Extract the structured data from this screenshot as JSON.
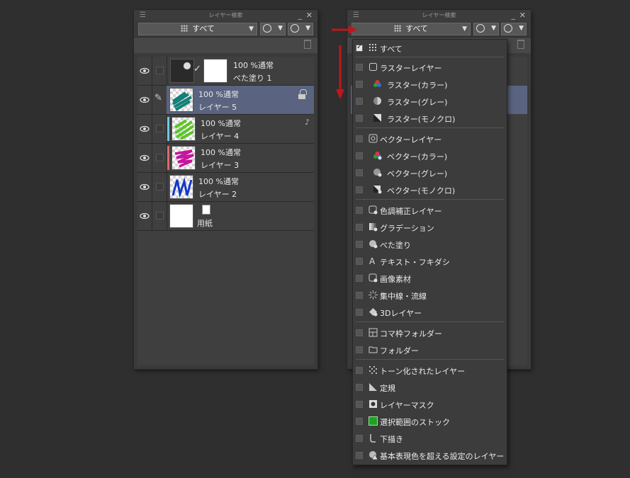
{
  "left_panel": {
    "title": "レイヤー検索",
    "filter_value": "すべて",
    "layers": [
      {
        "mode": "100 %通常",
        "name": "べた塗り 1",
        "selected": false
      },
      {
        "mode": "100 %通常",
        "name": "レイヤー 5",
        "selected": true
      },
      {
        "mode": "100 %通常",
        "name": "レイヤー 4",
        "selected": false,
        "color": "#6ec8e6"
      },
      {
        "mode": "100 %通常",
        "name": "レイヤー 3",
        "selected": false,
        "color": "#e06a6a"
      },
      {
        "mode": "100 %通常",
        "name": "レイヤー 2",
        "selected": false
      },
      {
        "mode": "",
        "name": "用紙",
        "selected": false
      }
    ]
  },
  "right_panel": {
    "title": "レイヤー検索",
    "filter_value": "すべて"
  },
  "dropdown": {
    "items": [
      {
        "label": "すべて",
        "checked": true,
        "icon": "grid-icon"
      },
      {
        "label": "ラスターレイヤー",
        "checked": false,
        "icon": "raster-layer-icon"
      },
      {
        "label": "ラスター(カラー)",
        "checked": false,
        "icon": "color-icon"
      },
      {
        "label": "ラスター(グレー)",
        "checked": false,
        "icon": "gray-icon"
      },
      {
        "label": "ラスター(モノクロ)",
        "checked": false,
        "icon": "mono-icon"
      },
      {
        "label": "ベクターレイヤー",
        "checked": false,
        "icon": "vector-layer-icon"
      },
      {
        "label": "ベクター(カラー)",
        "checked": false,
        "icon": "vector-color-icon"
      },
      {
        "label": "ベクター(グレー)",
        "checked": false,
        "icon": "vector-gray-icon"
      },
      {
        "label": "ベクター(モノクロ)",
        "checked": false,
        "icon": "vector-mono-icon"
      },
      {
        "label": "色調補正レイヤー",
        "checked": false,
        "icon": "tonal-correction-icon"
      },
      {
        "label": "グラデーション",
        "checked": false,
        "icon": "gradient-icon"
      },
      {
        "label": "べた塗り",
        "checked": false,
        "icon": "fill-icon"
      },
      {
        "label": "テキスト・フキダシ",
        "checked": false,
        "icon": "text-icon"
      },
      {
        "label": "画像素材",
        "checked": false,
        "icon": "image-material-icon"
      },
      {
        "label": "集中線・流線",
        "checked": false,
        "icon": "speed-lines-icon"
      },
      {
        "label": "3Dレイヤー",
        "checked": false,
        "icon": "3d-icon"
      },
      {
        "label": "コマ枠フォルダー",
        "checked": false,
        "icon": "frame-folder-icon"
      },
      {
        "label": "フォルダー",
        "checked": false,
        "icon": "folder-icon"
      },
      {
        "label": "トーン化されたレイヤー",
        "checked": false,
        "icon": "tone-icon"
      },
      {
        "label": "定規",
        "checked": false,
        "icon": "ruler-icon"
      },
      {
        "label": "レイヤーマスク",
        "checked": false,
        "icon": "layer-mask-icon"
      },
      {
        "label": "選択範囲のストック",
        "checked": false,
        "icon": "selection-stock-icon"
      },
      {
        "label": "下描き",
        "checked": false,
        "icon": "draft-icon"
      },
      {
        "label": "基本表現色を超える設定のレイヤー",
        "checked": false,
        "icon": "warning-icon"
      }
    ]
  }
}
